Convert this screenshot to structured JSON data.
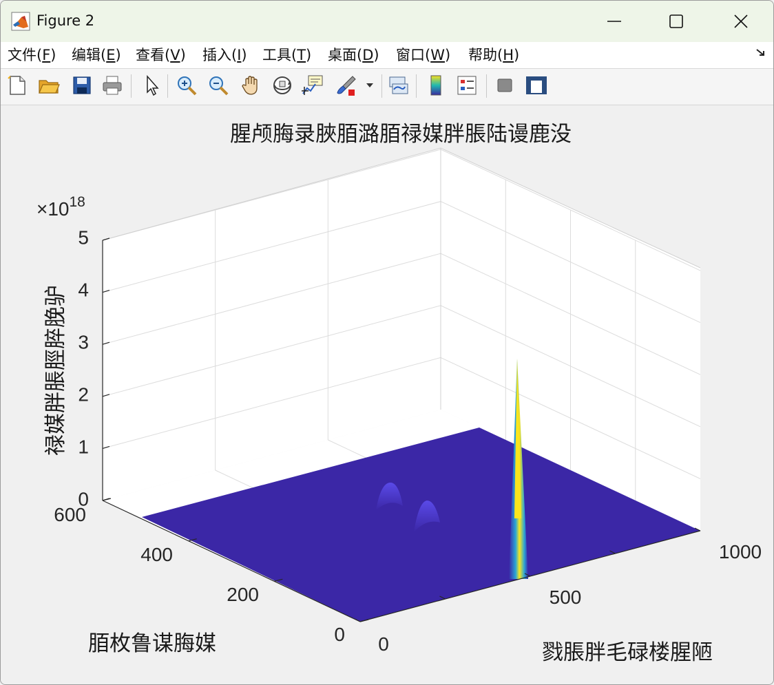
{
  "window": {
    "title": "Figure 2"
  },
  "menu": {
    "items": [
      {
        "label": "文件(",
        "key": "F",
        "tail": ")"
      },
      {
        "label": "编辑(",
        "key": "E",
        "tail": ")"
      },
      {
        "label": "查看(",
        "key": "V",
        "tail": ")"
      },
      {
        "label": "插入(",
        "key": "I",
        "tail": ")"
      },
      {
        "label": "工具(",
        "key": "T",
        "tail": ")"
      },
      {
        "label": "桌面(",
        "key": "D",
        "tail": ")"
      },
      {
        "label": "窗口(",
        "key": "W",
        "tail": ")"
      },
      {
        "label": "帮助(",
        "key": "H",
        "tail": ")"
      }
    ]
  },
  "toolbar": {
    "icons": [
      "new-file-icon",
      "open-folder-icon",
      "save-icon",
      "print-icon",
      "select-arrow-icon",
      "zoom-in-icon",
      "zoom-out-icon",
      "pan-hand-icon",
      "rotate-3d-icon",
      "data-cursor-icon",
      "brush-icon",
      "brush-dropdown-icon",
      "link-plot-icon",
      "insert-colorbar-icon",
      "insert-legend-icon",
      "hide-plot-tools-icon",
      "show-plot-tools-icon"
    ]
  },
  "chart_data": {
    "type": "surface",
    "title": "腥颅脢录脥脜潞脜禄媒胖脹陆谩鹿没",
    "xlabel": "戮脹胖毛碌楼腥陋",
    "ylabel": "脜枚鲁谋脢媒",
    "zlabel": "禄媒胖脹脛脺脕驴",
    "x_ticks": [
      "0",
      "500",
      "1000"
    ],
    "y_ticks": [
      "0",
      "200",
      "400",
      "600"
    ],
    "z_ticks": [
      "0",
      "1",
      "2",
      "3",
      "4",
      "5"
    ],
    "z_exponent": "×10",
    "z_exponent_power": "18",
    "xlim": [
      0,
      1000
    ],
    "ylim": [
      0,
      600
    ],
    "zlim": [
      0,
      5e+18
    ],
    "grid": true,
    "peaks": [
      {
        "x": 600,
        "y": 200,
        "z": 2.7e+18,
        "description": "main sharp peak"
      },
      {
        "x": 450,
        "y": 400,
        "z": 4.5e+17,
        "description": "small bump"
      },
      {
        "x": 530,
        "y": 330,
        "z": 4.5e+17,
        "description": "small bump"
      }
    ],
    "colors": {
      "base": "#3b27a6",
      "peak_mid": "#20b0c0",
      "peak_top": "#f9e21c",
      "bump": "#4a3ad8"
    }
  }
}
